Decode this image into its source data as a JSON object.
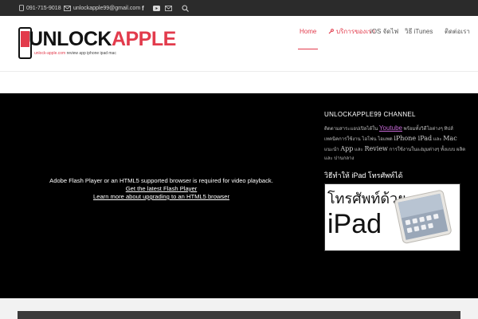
{
  "topbar": {
    "phone": "091-715-9018",
    "email": "unlockapple99@gmail.com",
    "icons": [
      "phone-icon",
      "mail-icon",
      "facebook-icon",
      "youtube-icon",
      "mail-icon",
      "search-icon"
    ]
  },
  "logo": {
    "text_dark": "UNLOCK",
    "text_red": "APPLE",
    "tagline_url": "unlock-apple.com",
    "tagline_rest": " review app iphone ipad mac"
  },
  "nav": {
    "home": "Home",
    "service": "บริการของเรา",
    "ios": "iOS จัดไฟ",
    "itunes": "วิธี iTunes",
    "contact": "ติดต่อเรา"
  },
  "video": {
    "message": "Adobe Flash Player or an HTML5 supported browser is required for video playback.",
    "link1": "Get the latest Flash Player",
    "link2": "Learn more about upgrading to an HTML5 browser"
  },
  "sidebar": {
    "title": "UNLOCKAPPLE99  CHANNEL",
    "text_a": "ติดตามสาระแอปเปิลได้ใน ",
    "link": "Youtube",
    "text_b": " พร้อมทั้งวิดีโอต่างๆ ทิปส์ เทคนิคการใช้งาน",
    "text_c": " ไอโฟน ไอแพด ",
    "big1": "iPhone iPad",
    "text_d": " และ ",
    "big2": "Mac",
    "text_e": " แนะนำ ",
    "big3": "App",
    "text_f": " และ ",
    "big4": "Review",
    "text_g": " การใช้งานในแง่มุมต่างๆ ทั้งแบบ ผลิต และ ปานกลาง",
    "title2": "วิธีทำให้  iPad  โทรศัพท์ได้",
    "ad_line1": "โทรศัพท์ด้วย",
    "ad_line2": "iPad"
  },
  "colors": {
    "accent": "#e23b4c",
    "topbar_bg": "#2b2b2b",
    "main_bg": "#000000",
    "link_purple": "#c86ad8"
  }
}
